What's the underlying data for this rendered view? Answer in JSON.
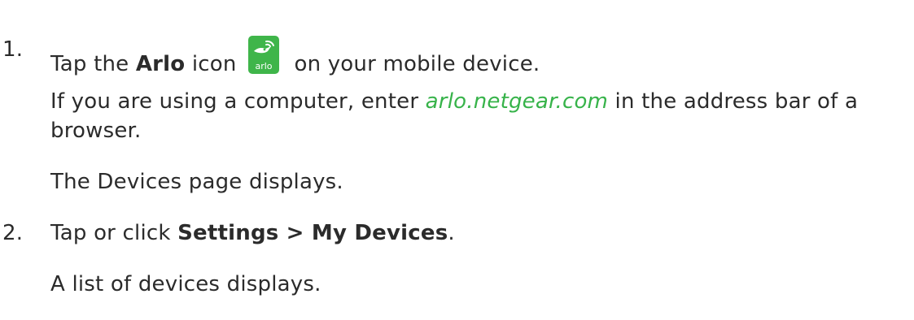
{
  "steps": [
    {
      "number": "1.",
      "main": {
        "before": "Tap the ",
        "bold": "Arlo",
        "middle": " icon ",
        "after": " on your mobile device."
      },
      "app_icon": {
        "name": "arlo-app-icon",
        "label": "arlo",
        "color": "#3fb54a"
      },
      "note": {
        "before": "If you are using a computer, enter ",
        "link": "arlo.netgear.com",
        "after": " in the address bar of a",
        "continuation": "browser."
      },
      "result": "The Devices page displays."
    },
    {
      "number": "2.",
      "main": {
        "before": "Tap or click ",
        "bold": "Settings > My Devices",
        "after": "."
      },
      "result": "A list of devices displays."
    }
  ],
  "colors": {
    "text": "#2b2b2b",
    "link": "#37b34a",
    "brand": "#3fb54a"
  }
}
